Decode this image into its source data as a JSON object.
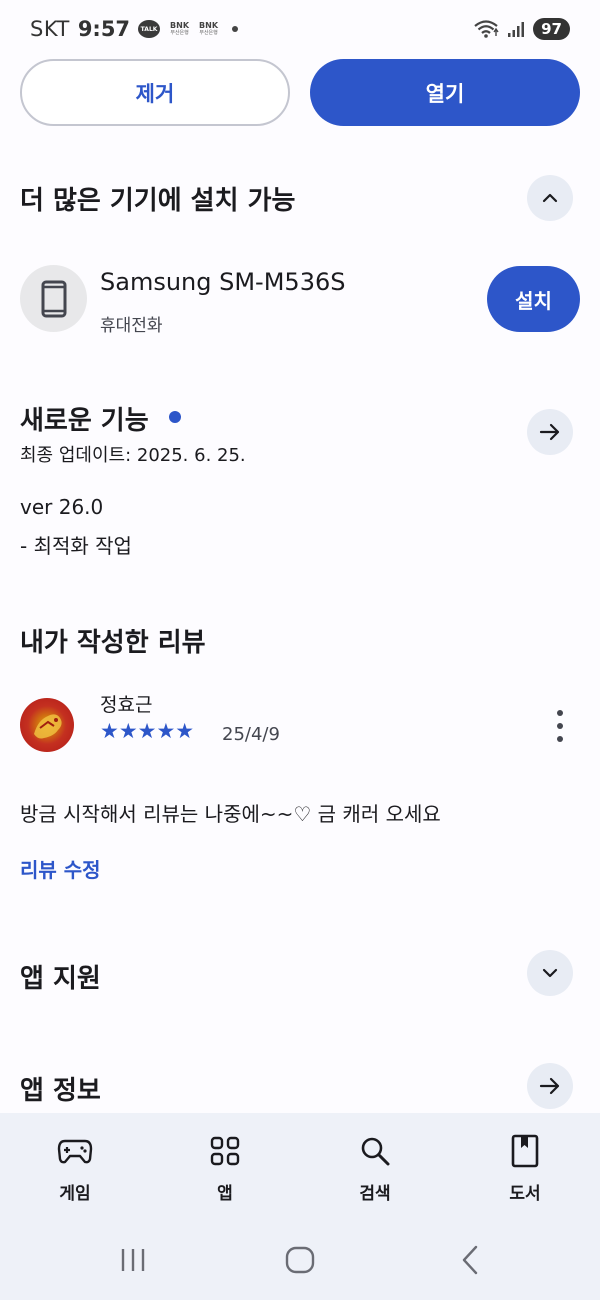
{
  "status_bar": {
    "carrier": "SKT",
    "time": "9:57",
    "talk_badge": "TALK",
    "bank1": {
      "name": "BNK",
      "sub": "부산은행"
    },
    "bank2": {
      "name": "BNK",
      "sub": "부산은행"
    },
    "battery": "97",
    "icons": [
      "wifi-icon",
      "signal-icon"
    ]
  },
  "actions": {
    "remove_label": "제거",
    "open_label": "열기"
  },
  "more_devices": {
    "title": "더 많은 기기에 설치 가능",
    "device_name": "Samsung SM-M536S",
    "device_type": "휴대전화",
    "install_label": "설치"
  },
  "whats_new": {
    "title": "새로운 기능",
    "last_update": "최종 업데이트: 2025. 6. 25.",
    "version": "ver 26.0",
    "note": "- 최적화 작업"
  },
  "my_review": {
    "title": "내가 작성한 리뷰",
    "reviewer": "정효근",
    "rating": 5,
    "stars": "★★★★★",
    "date": "25/4/9",
    "text": "방금 시작해서 리뷰는 나중에~~♡ 금 캐러 오세요",
    "edit_label": "리뷰 수정"
  },
  "app_support": {
    "title": "앱 지원"
  },
  "app_info": {
    "title": "앱 정보"
  },
  "bottom_nav": {
    "items": [
      {
        "label": "게임",
        "icon": "gamepad-icon"
      },
      {
        "label": "앱",
        "icon": "apps-grid-icon"
      },
      {
        "label": "검색",
        "icon": "search-icon"
      },
      {
        "label": "도서",
        "icon": "book-icon"
      }
    ]
  },
  "system_nav": [
    "recents-icon",
    "home-icon",
    "back-icon"
  ],
  "colors": {
    "accent": "#2d56c9",
    "background": "#fdfcff",
    "circle_button": "#e8ecf4",
    "nav_background": "#eef1f8"
  }
}
